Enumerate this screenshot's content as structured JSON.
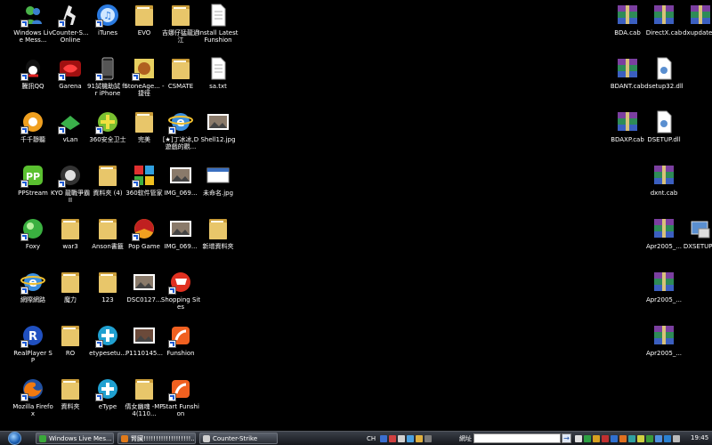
{
  "desktop": {
    "icons": [
      {
        "label": "Windows Live Mess...",
        "kind": "messenger"
      },
      {
        "label": "Counter-S... Online",
        "kind": "cs"
      },
      {
        "label": "iTunes",
        "kind": "itunes"
      },
      {
        "label": "EVO",
        "kind": "folder"
      },
      {
        "label": "吉娜仔猛龍過江",
        "kind": "folder"
      },
      {
        "label": "Install Latest Funshion",
        "kind": "doc"
      },
      {
        "label": "騰訊QQ",
        "kind": "qq"
      },
      {
        "label": "Garena",
        "kind": "garena"
      },
      {
        "label": "91試機助試 for iPhone",
        "kind": "iphone"
      },
      {
        "label": "StoneAge... - 捷徑",
        "kind": "stoneage"
      },
      {
        "label": "CSMATE",
        "kind": "folder"
      },
      {
        "label": "sa.txt",
        "kind": "doc"
      },
      {
        "label": "千千靜聽",
        "kind": "ttplayer"
      },
      {
        "label": "vLan",
        "kind": "vlan"
      },
      {
        "label": "360安全卫士",
        "kind": "s360"
      },
      {
        "label": "完美",
        "kind": "folder"
      },
      {
        "label": "[★]丁冰冰,D 遊戲的觀...",
        "kind": "ie"
      },
      {
        "label": "Shell12.jpg",
        "kind": "image"
      },
      {
        "label": "PPStream",
        "kind": "pps"
      },
      {
        "label": "KYO 龍戰爭霸II",
        "kind": "kyo"
      },
      {
        "label": "資料夾 (4)",
        "kind": "folder"
      },
      {
        "label": "360软件管家",
        "kind": "s360mgr"
      },
      {
        "label": "IMG_069...",
        "kind": "photo"
      },
      {
        "label": "未命名.jpg",
        "kind": "window"
      },
      {
        "label": "Foxy",
        "kind": "foxy"
      },
      {
        "label": "war3",
        "kind": "folder"
      },
      {
        "label": "Anson書籤",
        "kind": "folder"
      },
      {
        "label": "Pop Game",
        "kind": "popgame"
      },
      {
        "label": "IMG_069...",
        "kind": "photo"
      },
      {
        "label": "新增資料夾",
        "kind": "folder"
      },
      {
        "label": "網際網路",
        "kind": "ie"
      },
      {
        "label": "魔力",
        "kind": "folder"
      },
      {
        "label": "123",
        "kind": "folder"
      },
      {
        "label": "DSC0127...",
        "kind": "photo2"
      },
      {
        "label": "Shopping Sites",
        "kind": "shopping"
      },
      {
        "label": "RealPlayer SP",
        "kind": "realplayer"
      },
      {
        "label": "RO",
        "kind": "folder"
      },
      {
        "label": "etypesetu...",
        "kind": "etype"
      },
      {
        "label": "P1110145...",
        "kind": "photo3"
      },
      {
        "label": "Funshion",
        "kind": "funshion"
      },
      {
        "label": "Mozilla Firefox",
        "kind": "firefox"
      },
      {
        "label": "資料夾",
        "kind": "folder"
      },
      {
        "label": "eType",
        "kind": "etype"
      },
      {
        "label": "倩女幽魂 -MP4(110...",
        "kind": "folder"
      },
      {
        "label": "Start Funshion",
        "kind": "funshion"
      },
      {
        "label": "BDA.cab",
        "kind": "rar"
      },
      {
        "label": "DirectX.cab",
        "kind": "rar"
      },
      {
        "label": "dxupdate...",
        "kind": "rar"
      },
      {
        "label": "BDANT.cab",
        "kind": "rar"
      },
      {
        "label": "dsetup32.dll",
        "kind": "dll"
      },
      {
        "label": "BDAXP.cab",
        "kind": "rar"
      },
      {
        "label": "DSETUP.dll",
        "kind": "dll"
      },
      {
        "label": "dxnt.cab",
        "kind": "rar"
      },
      {
        "label": "Apr2005_...",
        "kind": "rar"
      },
      {
        "label": "DXSETUP...",
        "kind": "setup"
      },
      {
        "label": "Apr2005_...",
        "kind": "rar"
      },
      {
        "label": "Apr2005_...",
        "kind": "rar"
      }
    ]
  },
  "taskbar": {
    "buttons": [
      {
        "label": "Windows Live Mes..."
      },
      {
        "label": "腎臟!!!!!!!!!!!!!!!!!!!..."
      },
      {
        "label": "Counter-Strike"
      }
    ],
    "lang": "CH",
    "address_label": "網址",
    "address_value": "",
    "go_label": "→",
    "clock": "19:45"
  },
  "colors": {
    "folder": "#e8c66a",
    "rar_a": "#7b3fa0",
    "rar_b": "#2e8b57",
    "taskbar": "#2b2f36"
  }
}
